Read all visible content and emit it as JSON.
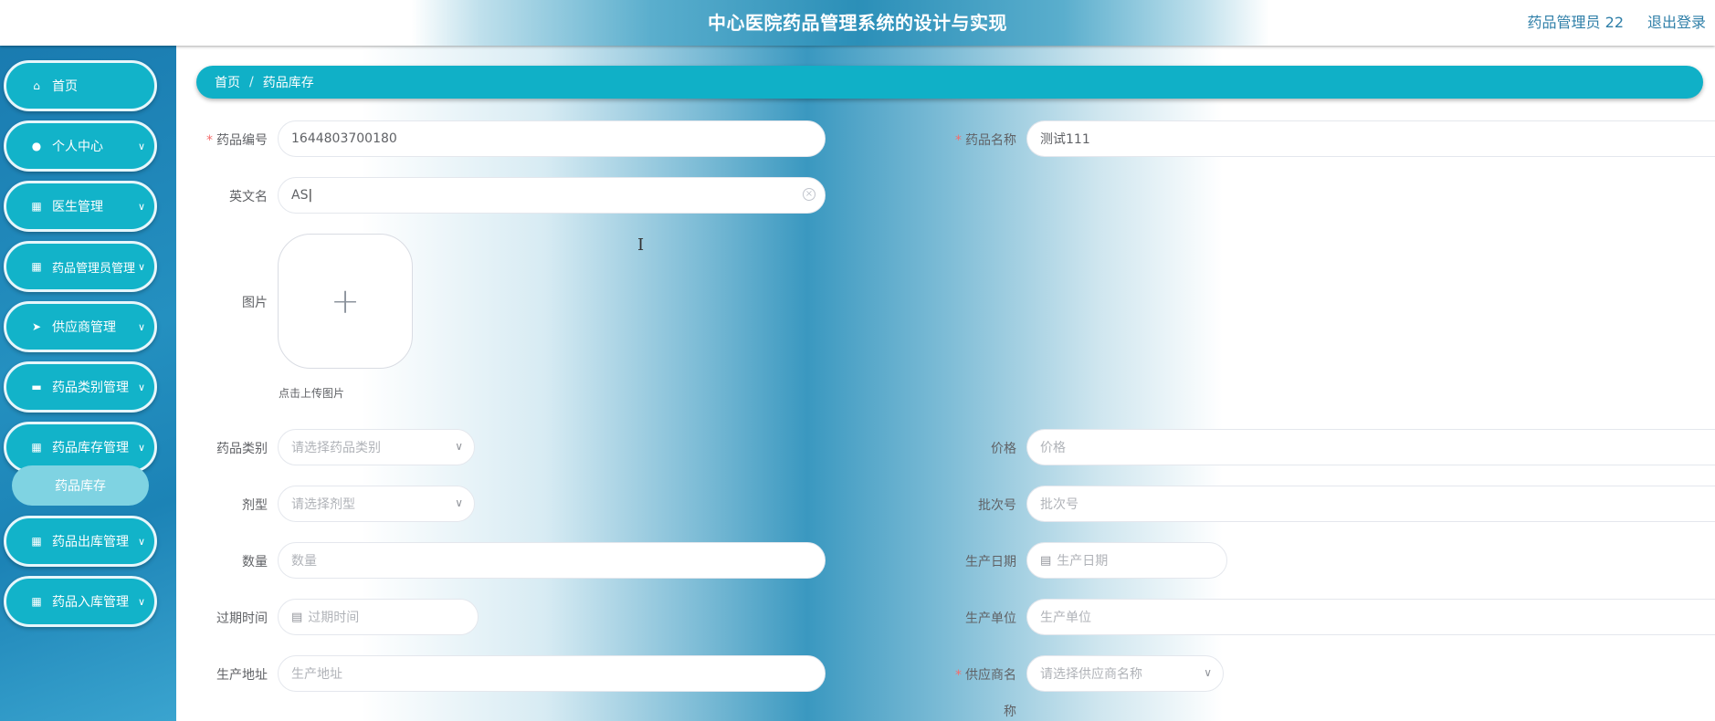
{
  "header": {
    "title": "中心医院药品管理系统的设计与实现",
    "user": "药品管理员 22",
    "logout": "退出登录"
  },
  "sidebar": {
    "items": [
      {
        "label": "首页",
        "icon": "home-icon",
        "has_arrow": false
      },
      {
        "label": "个人中心",
        "icon": "user-icon",
        "has_arrow": true
      },
      {
        "label": "医生管理",
        "icon": "grid-icon",
        "has_arrow": true
      },
      {
        "label": "药品管理员管理",
        "icon": "grid-icon",
        "has_arrow": true
      },
      {
        "label": "供应商管理",
        "icon": "send-icon",
        "has_arrow": true
      },
      {
        "label": "药品类别管理",
        "icon": "briefcase-icon",
        "has_arrow": true
      },
      {
        "label": "药品库存管理",
        "icon": "grid-icon",
        "has_arrow": true
      },
      {
        "label": "药品出库管理",
        "icon": "grid-icon",
        "has_arrow": true
      },
      {
        "label": "药品入库管理",
        "icon": "grid-icon",
        "has_arrow": true
      }
    ],
    "active_sub_item": "药品库存"
  },
  "breadcrumb": {
    "home": "首页",
    "separator": "/",
    "current": "药品库存"
  },
  "form": {
    "drug_code": {
      "label": "药品编号",
      "value": "1644803700180",
      "required": true
    },
    "drug_name": {
      "label": "药品名称",
      "value": "测试111",
      "required": true
    },
    "english_name": {
      "label": "英文名",
      "value": "AS"
    },
    "image": {
      "label": "图片",
      "hint": "点击上传图片"
    },
    "category": {
      "label": "药品类别",
      "placeholder": "请选择药品类别"
    },
    "price": {
      "label": "价格",
      "placeholder": "价格"
    },
    "dosage_form": {
      "label": "剂型",
      "placeholder": "请选择剂型"
    },
    "batch_no": {
      "label": "批次号",
      "placeholder": "批次号"
    },
    "quantity": {
      "label": "数量",
      "placeholder": "数量"
    },
    "production_date": {
      "label": "生产日期",
      "placeholder": "生产日期"
    },
    "expiry_date": {
      "label": "过期时间",
      "placeholder": "过期时间"
    },
    "manufacturer": {
      "label": "生产单位",
      "placeholder": "生产单位"
    },
    "production_address": {
      "label": "生产地址",
      "placeholder": "生产地址"
    },
    "supplier_name": {
      "label_line1": "供应商名",
      "label_line2": "称",
      "placeholder": "请选择供应商名称",
      "required": true
    }
  },
  "colors": {
    "accent": "#12b3c9",
    "sidebar_bg": "#1f88ba",
    "required_star": "#f56c6c"
  }
}
